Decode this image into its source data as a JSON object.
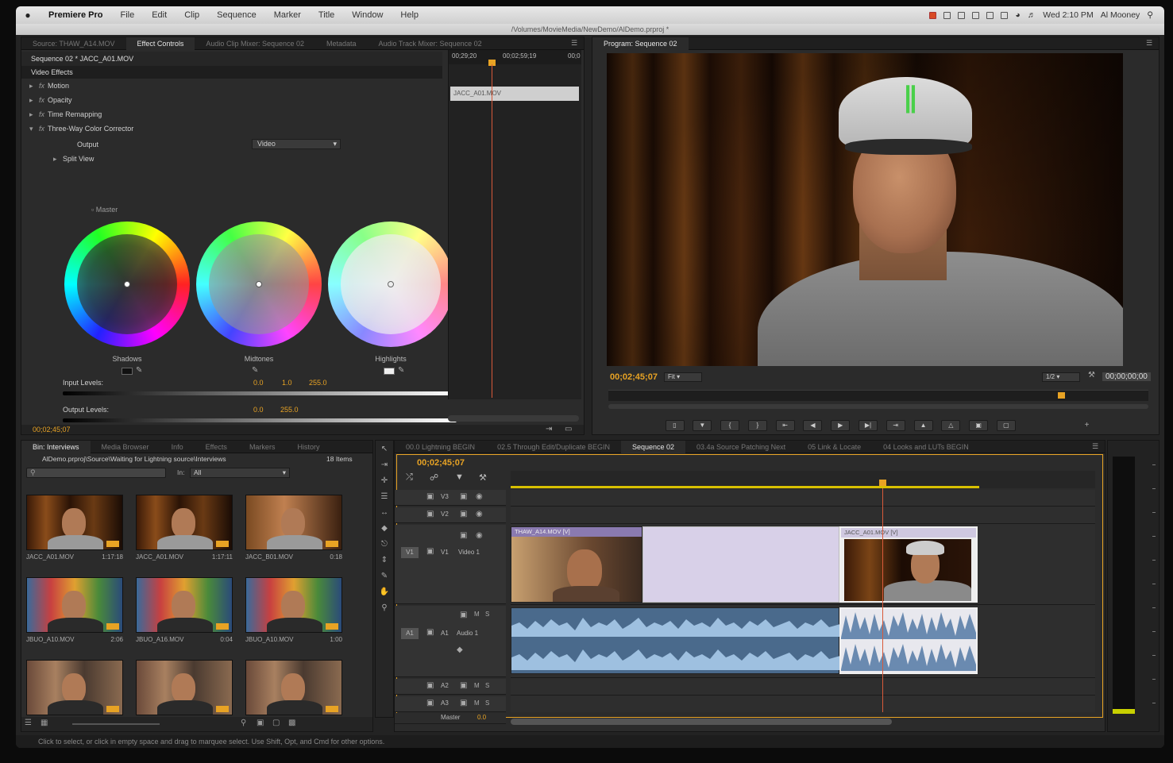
{
  "menubar": {
    "app": "Premiere Pro",
    "items": [
      "File",
      "Edit",
      "Clip",
      "Sequence",
      "Marker",
      "Title",
      "Window",
      "Help"
    ],
    "clock": "Wed 2:10 PM",
    "user": "Al Mooney"
  },
  "path": "/Volumes/MovieMedia/NewDemo/AlDemo.prproj *",
  "source_panel": {
    "tabs": [
      "Source: THAW_A14.MOV",
      "Effect Controls",
      "Audio Clip Mixer: Sequence 02",
      "Metadata",
      "Audio Track Mixer: Sequence 02"
    ],
    "sequence_label": "Sequence 02 * JACC_A01.MOV",
    "timecodes": [
      "00;29;20",
      "00;02;59;19",
      "00;0"
    ],
    "clip_bar": "JACC_A01.MOV",
    "section": "Video Effects",
    "effects": [
      "Motion",
      "Opacity",
      "Time Remapping",
      "Three-Way Color Corrector"
    ],
    "output_label": "Output",
    "output_value": "Video",
    "split_view": "Split View",
    "master_label": "Master",
    "wheels": [
      "Shadows",
      "Midtones",
      "Highlights"
    ],
    "input_levels_label": "Input Levels:",
    "input_levels": [
      "0.0",
      "1.0",
      "255.0"
    ],
    "output_levels_label": "Output Levels:",
    "output_levels": [
      "0.0",
      "255.0"
    ],
    "timecode": "00;02;45;07"
  },
  "program": {
    "tab": "Program: Sequence 02",
    "timecode": "00;02;45;07",
    "fit": "Fit",
    "quality": "1/2",
    "duration": "00;00;00;00"
  },
  "project": {
    "tabs": [
      "Bin: Interviews",
      "Media Browser",
      "Info",
      "Effects",
      "Markers",
      "History"
    ],
    "path": "AlDemo.prproj\\Source\\Waiting for Lightning source\\Interviews",
    "count": "18 Items",
    "in_label": "In:",
    "in_value": "All",
    "clips": [
      {
        "name": "JACC_A01.MOV",
        "dur": "1:17:18"
      },
      {
        "name": "JACC_A01.MOV",
        "dur": "1:17:11"
      },
      {
        "name": "JACC_B01.MOV",
        "dur": "0:18"
      },
      {
        "name": "JBUO_A10.MOV",
        "dur": "2:06"
      },
      {
        "name": "JBUO_A16.MOV",
        "dur": "0:04"
      },
      {
        "name": "JBUO_A10.MOV",
        "dur": "1:00"
      },
      {
        "name": "",
        "dur": ""
      },
      {
        "name": "",
        "dur": ""
      },
      {
        "name": "",
        "dur": ""
      }
    ]
  },
  "timeline": {
    "tabs": [
      "00.0 Lightning BEGIN",
      "02.5 Through Edit/Duplicate BEGIN",
      "Sequence 02",
      "03.4a Source Patching Next",
      "05 Link & Locate",
      "04 Looks and LUTs BEGIN"
    ],
    "timecode": "00;02;45;07",
    "tracks": {
      "v3": "V3",
      "v2": "V2",
      "v1": "V1",
      "v1_name": "Video 1",
      "a1": "A1",
      "a1_name": "Audio 1",
      "a2": "A2",
      "a3": "A3",
      "master": "Master",
      "master_val": "0.0"
    },
    "clip1": "THAW_A14.MOV [V]",
    "clip2": "JACC_A01.MOV [V]"
  },
  "status": "Click to select, or click in empty space and drag to marquee select. Use Shift, Opt, and Cmd for other options."
}
